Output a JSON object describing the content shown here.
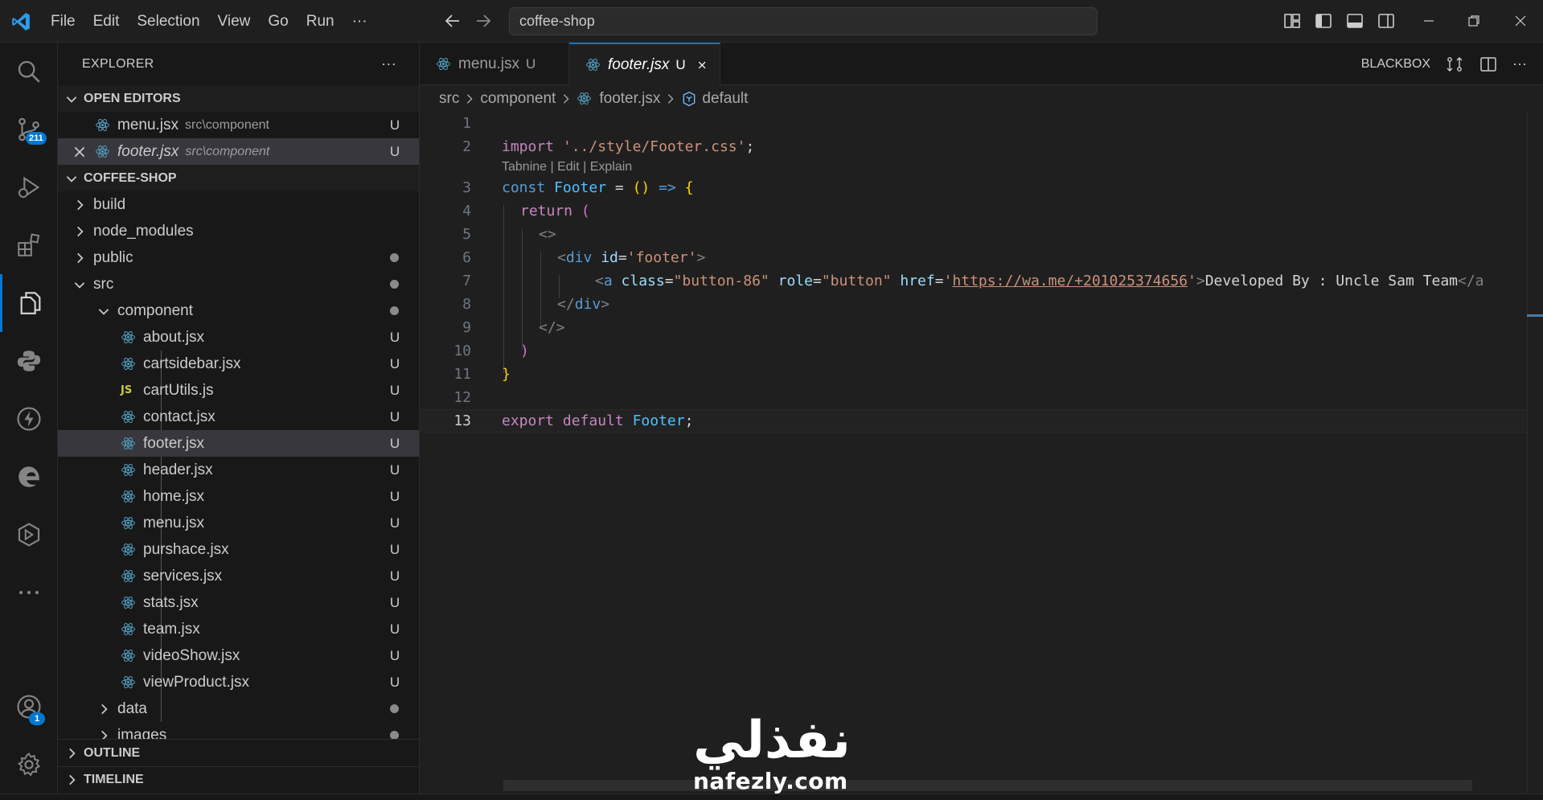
{
  "titlebar": {
    "menu": [
      "File",
      "Edit",
      "Selection",
      "View",
      "Go",
      "Run",
      "···"
    ],
    "search_value": "coffee-shop"
  },
  "activity": {
    "scm_badge": "211",
    "accounts_badge": "1"
  },
  "sidebar": {
    "title": "EXPLORER",
    "more": "···",
    "open_editors_label": "OPEN EDITORS",
    "open_editors": [
      {
        "name": "menu.jsx",
        "path": "src\\component",
        "status": "U"
      },
      {
        "name": "footer.jsx",
        "path": "src\\component",
        "status": "U"
      }
    ],
    "project_label": "COFFEE-SHOP",
    "tree": [
      {
        "name": "build"
      },
      {
        "name": "node_modules"
      },
      {
        "name": "public"
      },
      {
        "name": "src"
      },
      {
        "name": "component"
      }
    ],
    "files": [
      {
        "name": "about.jsx",
        "status": "U"
      },
      {
        "name": "cartsidebar.jsx",
        "status": "U"
      },
      {
        "name": "cartUtils.js",
        "status": "U"
      },
      {
        "name": "contact.jsx",
        "status": "U"
      },
      {
        "name": "footer.jsx",
        "status": "U"
      },
      {
        "name": "header.jsx",
        "status": "U"
      },
      {
        "name": "home.jsx",
        "status": "U"
      },
      {
        "name": "menu.jsx",
        "status": "U"
      },
      {
        "name": "purshace.jsx",
        "status": "U"
      },
      {
        "name": "services.jsx",
        "status": "U"
      },
      {
        "name": "stats.jsx",
        "status": "U"
      },
      {
        "name": "team.jsx",
        "status": "U"
      },
      {
        "name": "videoShow.jsx",
        "status": "U"
      },
      {
        "name": "viewProduct.jsx",
        "status": "U"
      }
    ],
    "after_folders": [
      {
        "name": "data"
      },
      {
        "name": "images"
      }
    ],
    "outline_label": "OUTLINE",
    "timeline_label": "TIMELINE"
  },
  "tabs": [
    {
      "name": "menu.jsx",
      "status": "U"
    },
    {
      "name": "footer.jsx",
      "status": "U"
    }
  ],
  "tab_actions": {
    "blackbox": "BLACKBOX",
    "more": "···"
  },
  "breadcrumb": {
    "p1": "src",
    "p2": "component",
    "p3": "footer.jsx",
    "p4": "default"
  },
  "codelens": "Tabnine | Edit | Explain",
  "code": {
    "line_numbers": [
      "1",
      "2",
      "3",
      "4",
      "5",
      "6",
      "7",
      "8",
      "9",
      "10",
      "11",
      "12",
      "13"
    ],
    "l2": {
      "kw": "import",
      "str": "'../style/Footer.css'",
      "end": ";"
    },
    "l3": {
      "kw": "const",
      "name": "Footer",
      "mid": " = ",
      "paren": "()",
      "arrow": " => ",
      "brace": "{"
    },
    "l4": {
      "kw": "return",
      "paren": "("
    },
    "l5": "<>",
    "l6": {
      "open": "<",
      "tag": "div",
      "attr": "id",
      "eq": "=",
      "val": "'footer'",
      "close": ">"
    },
    "l7": {
      "open": "<",
      "tag": "a",
      "a1": "class",
      "v1": "\"button-86\"",
      "a2": "role",
      "v2": "\"button\"",
      "a3": "href",
      "q1": "'",
      "url": "https://wa.me/+201025374656",
      "q2": "'",
      "close": ">",
      "text": "Developed By : Uncle Sam Team",
      "end": "</a"
    },
    "l8": {
      "open": "</",
      "tag": "div",
      "close": ">"
    },
    "l9": "</>",
    "l10": ")",
    "l11": "}",
    "l13": {
      "kw1": "export",
      "kw2": "default",
      "name": "Footer",
      "end": ";"
    }
  },
  "watermark": {
    "arabic": "نفذلي",
    "url": "nafezly.com"
  },
  "colors": {
    "accent": "#0078d4",
    "background": "#1f1f1f",
    "sidebar": "#181818"
  }
}
